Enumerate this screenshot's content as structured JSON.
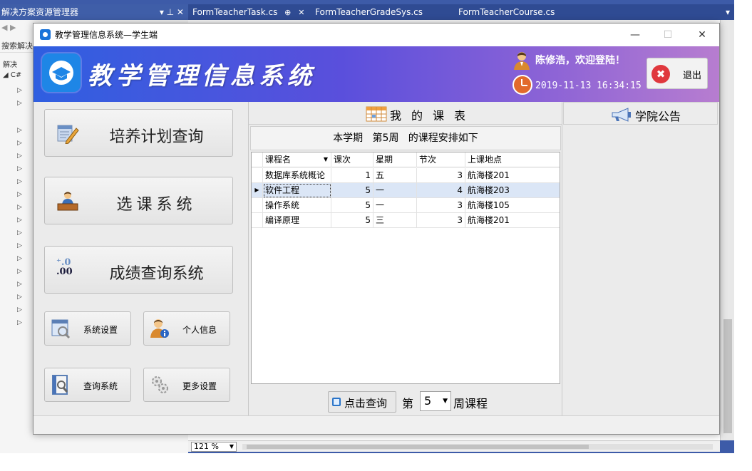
{
  "ide": {
    "solution_header": "解决方案资源管理器",
    "solution_pin": "▾ ⊥ ✕",
    "search_text": "搜索解决",
    "tree_node": "解决",
    "tabs": [
      {
        "label": "FormTeacherTask.cs"
      },
      {
        "label": "FormTeacherGradeSys.cs"
      },
      {
        "label": "FormTeacherCourse.cs"
      }
    ],
    "tab_pin": "⊕",
    "tab_close": "✕",
    "zoom": "121 %"
  },
  "window": {
    "title": "教学管理信息系统—学生端",
    "minimize": "—",
    "maximize": "☐",
    "close": "✕"
  },
  "banner": {
    "system_title": "教学管理信息系统",
    "welcome": "陈修浩，欢迎登陆！",
    "datetime": "2019-11-13 16:34:15",
    "exit_label": "退出",
    "exit_icon_glyph": "✖"
  },
  "nav": {
    "big_buttons": [
      {
        "label": "培养计划查询",
        "icon": "edit-plan-icon"
      },
      {
        "label": "选课系统",
        "icon": "user-at-desk-icon"
      },
      {
        "label": "成绩查询系统",
        "icon": "decimal-icon",
        "icon_text": ".0\n.00"
      }
    ],
    "small_buttons": [
      {
        "label": "系统设置",
        "icon": "settings-window-icon"
      },
      {
        "label": "个人信息",
        "icon": "user-info-icon"
      },
      {
        "label": "查询系统",
        "icon": "search-document-icon"
      },
      {
        "label": "更多设置",
        "icon": "gears-icon"
      }
    ]
  },
  "schedule": {
    "header": "我的课表",
    "subtitle": "本学期   第5周   的课程安排如下",
    "columns": [
      "课程名",
      "课次",
      "星期",
      "节次",
      "上课地点"
    ],
    "rows": [
      {
        "name": "数据库系统概论",
        "session": "1",
        "weekday": "五",
        "period": "3",
        "location": "航海楼201"
      },
      {
        "name": "软件工程",
        "session": "5",
        "weekday": "一",
        "period": "4",
        "location": "航海楼203"
      },
      {
        "name": "操作系统",
        "session": "5",
        "weekday": "一",
        "period": "3",
        "location": "航海楼105"
      },
      {
        "name": "编译原理",
        "session": "5",
        "weekday": "三",
        "period": "3",
        "location": "航海楼201"
      }
    ],
    "selected_row_index": 1,
    "query_button": "点击查询",
    "week_prefix": "第",
    "week_value": "5",
    "week_suffix": "周课程"
  },
  "notice": {
    "header": "学院公告"
  },
  "colors": {
    "banner_start": "#2f5fe0",
    "banner_end": "#b77dd0",
    "ide_chrome": "#3d5ba8",
    "selection": "#dbe6f6"
  }
}
